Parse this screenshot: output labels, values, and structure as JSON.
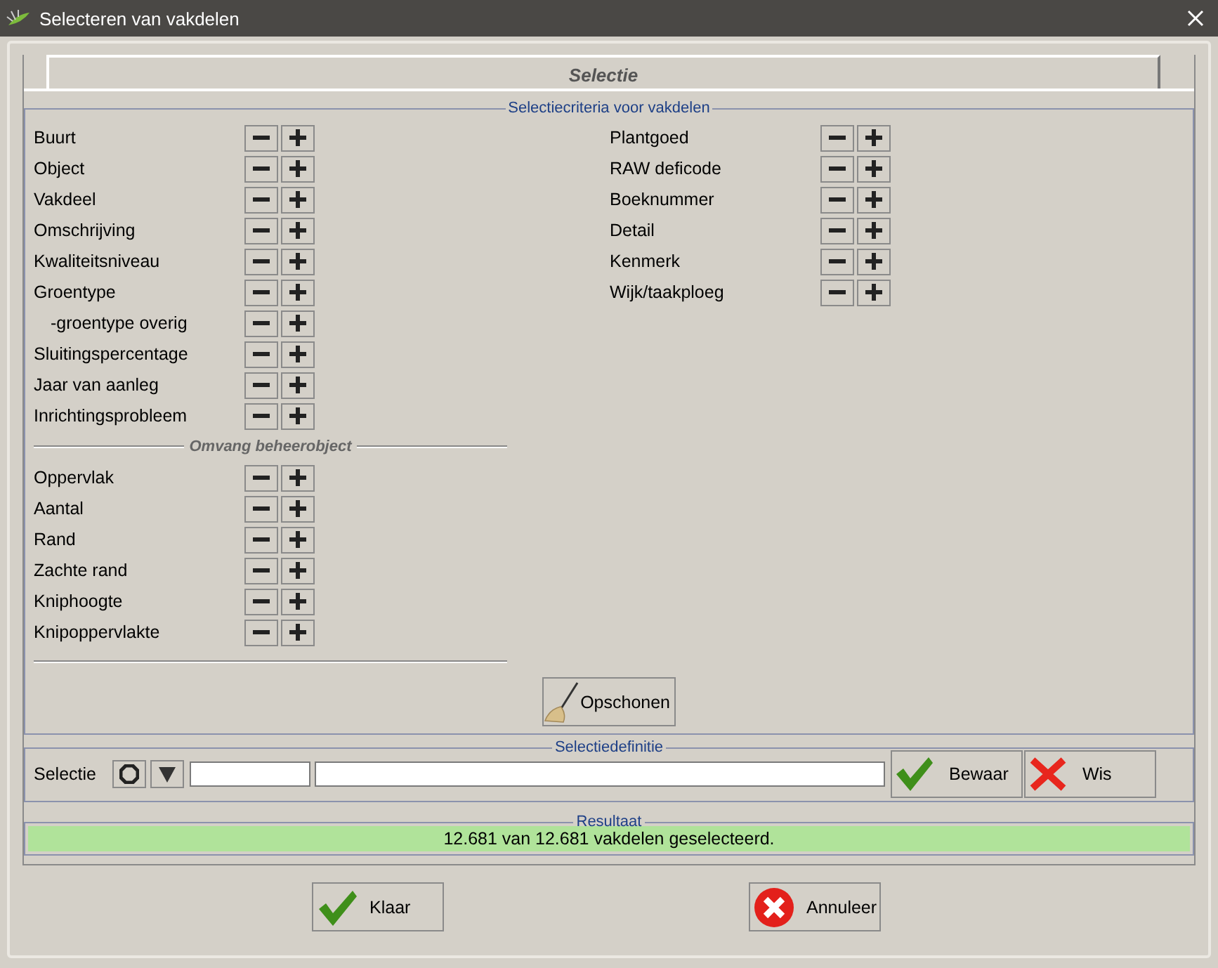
{
  "window": {
    "title": "Selecteren van vakdelen"
  },
  "tabs": [
    {
      "label": "Selectie",
      "selected": true
    }
  ],
  "criteria": {
    "title": "Selectiecriteria voor vakdelen",
    "left": [
      {
        "label": "Buurt"
      },
      {
        "label": "Object"
      },
      {
        "label": "Vakdeel"
      },
      {
        "label": "Omschrijving"
      },
      {
        "label": "Kwaliteitsniveau"
      },
      {
        "label": "Groentype",
        "children": [
          {
            "label": "-groentype overig"
          }
        ]
      },
      {
        "label": "Sluitingspercentage"
      },
      {
        "label": "Jaar van aanleg"
      },
      {
        "label": "Inrichtingsprobleem"
      }
    ],
    "subsection": {
      "title": "Omvang beheerobject",
      "items": [
        {
          "label": "Oppervlak"
        },
        {
          "label": "Aantal"
        },
        {
          "label": "Rand"
        },
        {
          "label": "Zachte rand"
        },
        {
          "label": "Kniphoogte"
        },
        {
          "label": "Knipoppervlakte"
        }
      ]
    },
    "right": [
      {
        "label": "Plantgoed"
      },
      {
        "label": "RAW deficode"
      },
      {
        "label": "Boeknummer"
      },
      {
        "label": "Detail"
      },
      {
        "label": "Kenmerk"
      },
      {
        "label": "Wijk/taakploeg"
      }
    ],
    "clear_button": "Opschonen"
  },
  "definition": {
    "title": "Selectiedefinitie",
    "label": "Selectie",
    "buttons": [
      {
        "label": "Bewaar",
        "kind": "save"
      },
      {
        "label": "Wis",
        "kind": "delete"
      }
    ]
  },
  "result": {
    "title": "Resultaat",
    "message": "12.681 van 12.681 vakdelen geselecteerd."
  },
  "buttons": [
    {
      "label": "Klaar",
      "kind": "ok"
    },
    {
      "label": "Annuleer",
      "kind": "cancel"
    }
  ]
}
